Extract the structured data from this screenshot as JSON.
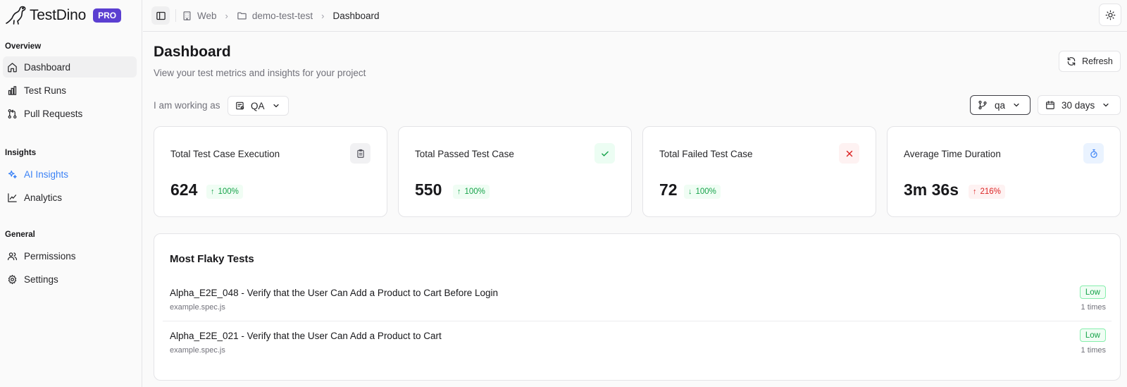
{
  "brand": {
    "name": "TestDino",
    "badge": "PRO"
  },
  "sidebar": {
    "sections": [
      {
        "label": "Overview"
      },
      {
        "label": "Insights"
      },
      {
        "label": "General"
      }
    ],
    "items": [
      {
        "label": "Dashboard",
        "icon": "home-icon",
        "active": true
      },
      {
        "label": "Test Runs",
        "icon": "bar-chart-icon"
      },
      {
        "label": "Pull Requests",
        "icon": "git-pull-request-icon"
      },
      {
        "label": "AI Insights",
        "icon": "sparkles-icon",
        "accent": "#3b82f6"
      },
      {
        "label": "Analytics",
        "icon": "line-chart-icon"
      },
      {
        "label": "Permissions",
        "icon": "users-icon"
      },
      {
        "label": "Settings",
        "icon": "gear-icon"
      }
    ]
  },
  "breadcrumb": {
    "items": [
      {
        "label": "Web",
        "icon": "building-icon"
      },
      {
        "label": "demo-test-test",
        "icon": "folder-icon"
      },
      {
        "label": "Dashboard"
      }
    ]
  },
  "header": {
    "title": "Dashboard",
    "subtitle": "View your test metrics and insights for your project",
    "refresh_label": "Refresh"
  },
  "filters": {
    "working_as_label": "I am working as",
    "role": "QA",
    "branch": "qa",
    "range": "30 days"
  },
  "cards": [
    {
      "label": "Total Test Case Execution",
      "value": "624",
      "change": "100%",
      "direction": "up",
      "tone": "green",
      "icon": "clipboard-icon"
    },
    {
      "label": "Total Passed Test Case",
      "value": "550",
      "change": "100%",
      "direction": "up",
      "tone": "green",
      "icon": "check-icon"
    },
    {
      "label": "Total Failed Test Case",
      "value": "72",
      "change": "100%",
      "direction": "down",
      "tone": "green",
      "icon": "x-icon"
    },
    {
      "label": "Average Time Duration",
      "value": "3m 36s",
      "change": "216%",
      "direction": "up",
      "tone": "red",
      "icon": "stopwatch-icon"
    }
  ],
  "flaky": {
    "title": "Most Flaky Tests",
    "rows": [
      {
        "name": "Alpha_E2E_048 - Verify that the User Can Add a Product to Cart Before Login",
        "file": "example.spec.js",
        "level": "Low",
        "count": "1 times"
      },
      {
        "name": "Alpha_E2E_021 - Verify that the User Can Add a Product to Cart",
        "file": "example.spec.js",
        "level": "Low",
        "count": "1 times"
      }
    ]
  },
  "colors": {
    "brand_badge": "#5b3fd1",
    "accent": "#3b82f6",
    "success": "#16a34a",
    "danger": "#dc2626"
  }
}
